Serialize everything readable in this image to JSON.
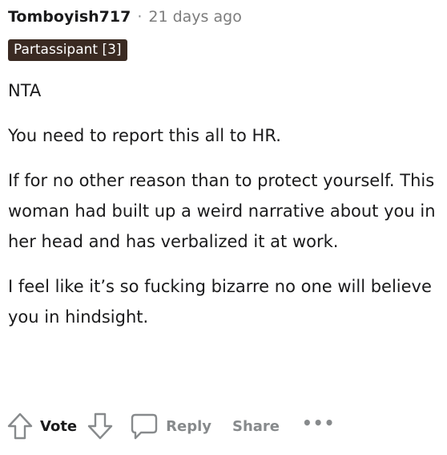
{
  "comment": {
    "username": "Tomboyish717",
    "separator": "·",
    "timestamp": "21 days ago",
    "flair": "Partassipant [3]",
    "paragraphs": [
      "NTA",
      "You need to report this all to HR.",
      "If for no other reason than to protect yourself. This woman had built up a weird narrative about you in her head and has verbalized it at work.",
      "I feel like it’s so fucking bizarre no one will believe you in hindsight."
    ]
  },
  "actions": {
    "vote_label": "Vote",
    "reply_label": "Reply",
    "share_label": "Share",
    "more_label": "•••"
  },
  "icons": {
    "upvote": "upvote-arrow-icon",
    "downvote": "downvote-arrow-icon",
    "reply": "speech-bubble-icon",
    "more": "more-options-icon"
  },
  "colors": {
    "text": "#1a1a1b",
    "muted": "#878a8c",
    "flair_bg": "#3a2a22",
    "flair_text": "#ffffff"
  }
}
